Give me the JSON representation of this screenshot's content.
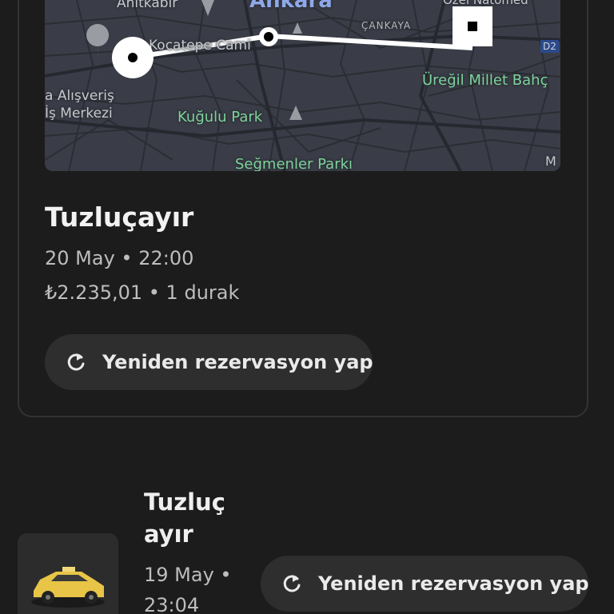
{
  "map": {
    "labels": {
      "anitkabir": "Anıtkabir",
      "ankara": "Ankara",
      "ozel": "Özel Natomed",
      "cankaya": "ÇANKAYA",
      "kocatepe": "Kocatepe Cami",
      "d2": "D2",
      "uregil": "Üreğil Millet Bahç",
      "alisveris": "a Alışveriş",
      "merkezi": "İş Merkezi",
      "kugulu": "Kuğulu Park",
      "segmenler": "Seğmenler Parkı",
      "m": "M"
    }
  },
  "trips": [
    {
      "destination": "Tuzluçayır",
      "datetime": "20 May • 22:00",
      "price_stops": "₺2.235,01 • 1 durak",
      "rebook_label": "Yeniden rezervasyon yap"
    },
    {
      "destination_line1": "Tuzluç",
      "destination_line2": "ayır",
      "date_line1": "19 May •",
      "date_line2": "23:04",
      "rebook_label": "Yeniden rezervasyon yap"
    }
  ],
  "icons": {
    "rebook": "refresh-icon",
    "vehicle": "taxi-car-icon",
    "pin_start": "route-start-icon",
    "pin_stop": "route-stop-icon",
    "pin_end": "route-end-icon"
  },
  "colors": {
    "background": "#1c1c1c",
    "card_border": "#333333",
    "map_bg": "#3a3d47",
    "route": "#ffffff",
    "park_label": "#7ed39c",
    "button_bg": "#2e2e2e",
    "taxi": "#e8c547"
  }
}
